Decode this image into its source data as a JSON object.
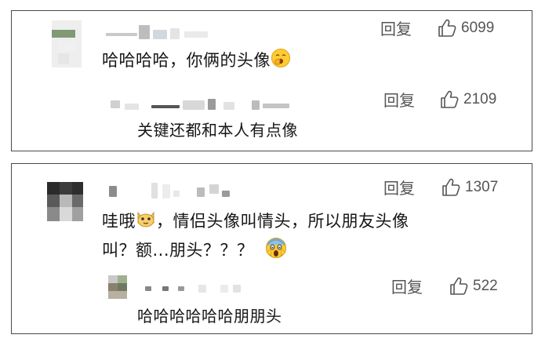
{
  "comments": [
    {
      "text_before_emoji": "哈哈哈哈，你俩的头像",
      "emoji": "yawning-face-emoji",
      "reply_label": "回复",
      "like_icon": "thumbs-up-icon",
      "likes": "6099",
      "reply": {
        "text": "关键还都和本人有点像",
        "reply_label": "回复",
        "likes": "2109"
      }
    },
    {
      "line1_part1": "哇哦",
      "line1_emoji": "cat-face-emoji",
      "line1_part2": "，情侣头像叫情头，所以朋友头像",
      "line2_text": "叫？额...朋头？？？",
      "line2_emoji": "screaming-face-emoji",
      "reply_label": "回复",
      "likes": "1307",
      "reply": {
        "text": "哈哈哈哈哈哈朋朋头",
        "reply_label": "回复",
        "likes": "522"
      }
    }
  ],
  "colors": {
    "border": "#4a4a4a",
    "text": "#161616",
    "secondary": "#555555",
    "blur": "#d6d6d6"
  }
}
